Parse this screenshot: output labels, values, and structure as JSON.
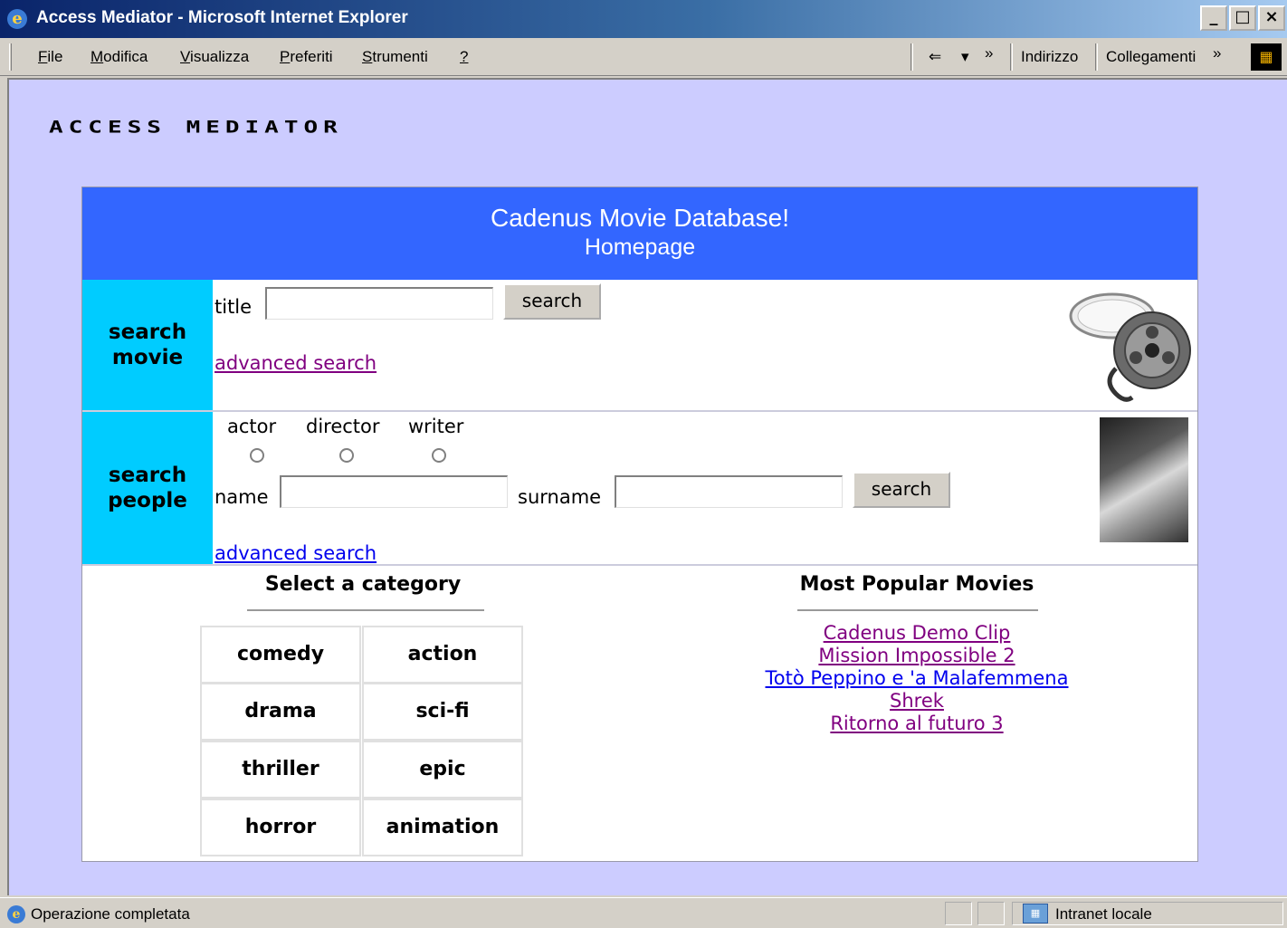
{
  "window": {
    "title": "Access Mediator - Microsoft Internet Explorer",
    "min": "_",
    "max": "□",
    "close": "×"
  },
  "menubar": {
    "items": [
      {
        "first": "F",
        "rest": "ile"
      },
      {
        "first": "M",
        "rest": "odifica"
      },
      {
        "first": "V",
        "rest": "isualizza"
      },
      {
        "first": "P",
        "rest": "referiti"
      },
      {
        "first": "S",
        "rest": "trumenti"
      },
      {
        "first": "?",
        "rest": ""
      }
    ],
    "back_glyph": "⇐",
    "dropdown_glyph": "▾",
    "more_glyph": "»",
    "address_label": "Indirizzo",
    "links_label": "Collegamenti",
    "links_more": "»"
  },
  "page": {
    "brand": "ACCESS MEDIATOR",
    "header_title": "Cadenus Movie Database!",
    "header_subtitle": "Homepage",
    "search_movie": {
      "side_label": "search movie",
      "title_label": "title",
      "title_value": "",
      "search_button": "search",
      "advanced_link": "advanced search"
    },
    "search_people": {
      "side_label": "search people",
      "roles": [
        "actor",
        "director",
        "writer"
      ],
      "name_label": "name",
      "name_value": "",
      "surname_label": "surname",
      "surname_value": "",
      "search_button": "search",
      "advanced_link": "advanced search"
    },
    "categories_title": "Select a category",
    "categories": [
      "comedy",
      "action",
      "drama",
      "sci-fi",
      "thriller",
      "epic",
      "horror",
      "animation"
    ],
    "popular_title": "Most Popular Movies",
    "popular_movies": [
      "Cadenus Demo Clip",
      "Mission Impossible 2",
      "Totò Peppino e 'a Malafemmena",
      "Shrek",
      "Ritorno al futuro 3"
    ]
  },
  "statusbar": {
    "text": "Operazione completata",
    "zone": "Intranet locale"
  },
  "colors": {
    "header_bg": "#3366ff",
    "side_bg": "#00ccff",
    "page_bg": "#ccccff",
    "visited_link": "#800080",
    "link": "#0000ee"
  }
}
